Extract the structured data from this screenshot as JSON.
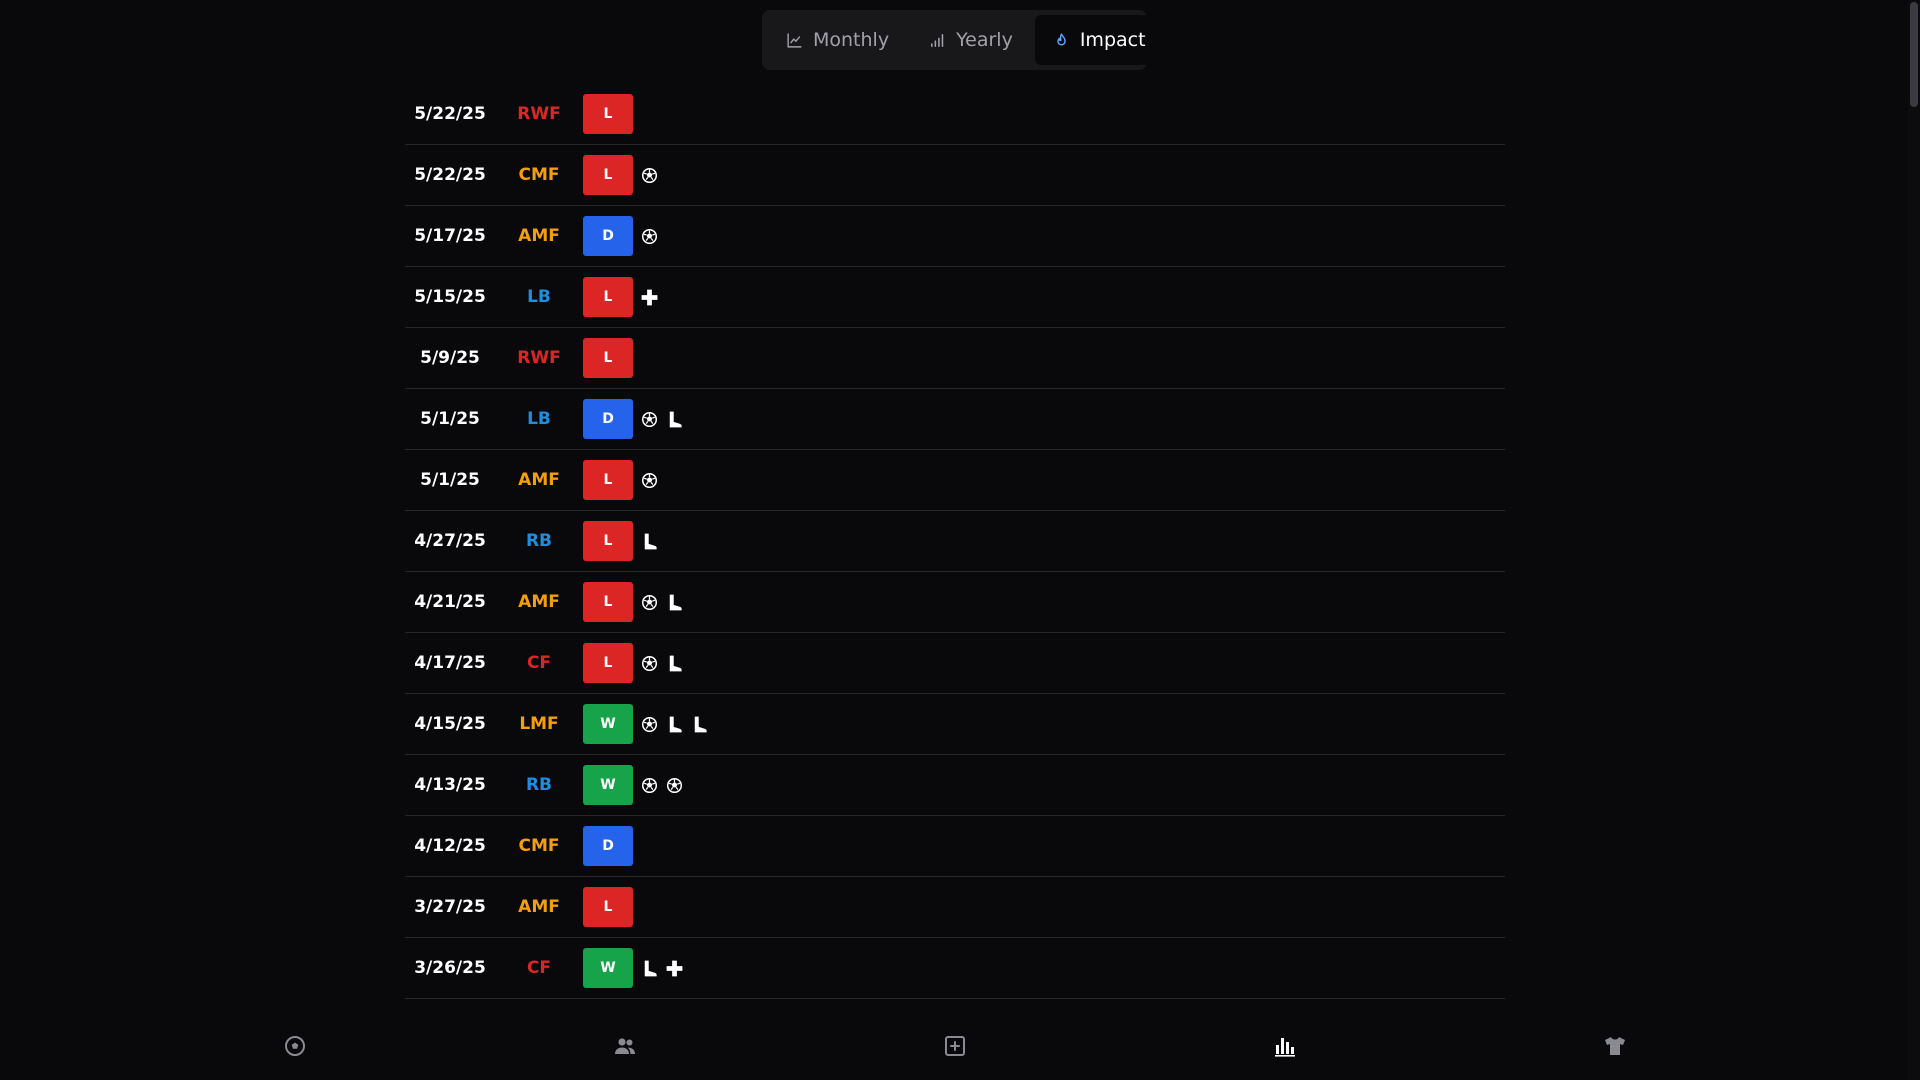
{
  "tabs": [
    {
      "label": "Monthly",
      "icon": "line-chart-icon",
      "active": false
    },
    {
      "label": "Yearly",
      "icon": "signal-bars-icon",
      "active": false
    },
    {
      "label": "Impact",
      "icon": "flame-icon",
      "active": true
    }
  ],
  "colors": {
    "position_attack": "#dc2626",
    "position_mid": "#f59e0b",
    "position_def": "#1d8fe0",
    "result_L": "#dc2626",
    "result_D": "#2563eb",
    "result_W": "#16a34a"
  },
  "matches": [
    {
      "date": "5/22/25",
      "position": "RWF",
      "result": "L",
      "events": []
    },
    {
      "date": "5/22/25",
      "position": "CMF",
      "result": "L",
      "events": [
        "goal"
      ]
    },
    {
      "date": "5/17/25",
      "position": "AMF",
      "result": "D",
      "events": [
        "goal"
      ]
    },
    {
      "date": "5/15/25",
      "position": "LB",
      "result": "L",
      "events": [
        "injury"
      ]
    },
    {
      "date": "5/9/25",
      "position": "RWF",
      "result": "L",
      "events": []
    },
    {
      "date": "5/1/25",
      "position": "LB",
      "result": "D",
      "events": [
        "goal",
        "assist"
      ]
    },
    {
      "date": "5/1/25",
      "position": "AMF",
      "result": "L",
      "events": [
        "goal"
      ]
    },
    {
      "date": "4/27/25",
      "position": "RB",
      "result": "L",
      "events": [
        "assist"
      ]
    },
    {
      "date": "4/21/25",
      "position": "AMF",
      "result": "L",
      "events": [
        "goal",
        "assist"
      ]
    },
    {
      "date": "4/17/25",
      "position": "CF",
      "result": "L",
      "events": [
        "goal",
        "assist"
      ]
    },
    {
      "date": "4/15/25",
      "position": "LMF",
      "result": "W",
      "events": [
        "goal",
        "assist",
        "assist"
      ]
    },
    {
      "date": "4/13/25",
      "position": "RB",
      "result": "W",
      "events": [
        "goal",
        "goal"
      ]
    },
    {
      "date": "4/12/25",
      "position": "CMF",
      "result": "D",
      "events": []
    },
    {
      "date": "3/27/25",
      "position": "AMF",
      "result": "L",
      "events": []
    },
    {
      "date": "3/26/25",
      "position": "CF",
      "result": "W",
      "events": [
        "assist",
        "injury"
      ]
    }
  ],
  "bottom_nav": [
    {
      "icon": "soccer-ball-icon",
      "active": false
    },
    {
      "icon": "users-icon",
      "active": false
    },
    {
      "icon": "plus-square-icon",
      "active": false
    },
    {
      "icon": "bar-chart-icon",
      "active": true
    },
    {
      "icon": "shirt-icon",
      "active": false
    }
  ]
}
